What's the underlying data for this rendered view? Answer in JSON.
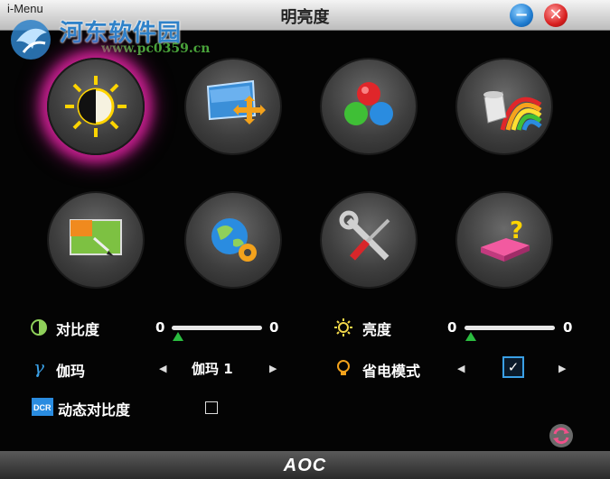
{
  "window": {
    "app_name": "i-Menu",
    "title": "明亮度",
    "minimize_icon": "minus-icon",
    "close_icon": "close-x-icon"
  },
  "watermark": {
    "name": "河东软件园",
    "url": "www.pc0359.cn"
  },
  "categories": [
    {
      "icon": "brightness-icon",
      "active": true
    },
    {
      "icon": "image-setup-icon",
      "active": false
    },
    {
      "icon": "color-setup-icon",
      "active": false
    },
    {
      "icon": "picture-boost-icon",
      "active": false
    },
    {
      "icon": "osd-setup-icon",
      "active": false
    },
    {
      "icon": "extra-globe-icon",
      "active": false
    },
    {
      "icon": "factory-tools-icon",
      "active": false
    },
    {
      "icon": "help-icon",
      "active": false
    }
  ],
  "settings": {
    "contrast": {
      "label": "对比度",
      "min_label": "0",
      "max_label": "0",
      "value": 0
    },
    "brightness": {
      "label": "亮度",
      "min_label": "0",
      "max_label": "0",
      "value": 0
    },
    "gamma": {
      "label": "伽玛",
      "value": "伽玛 1"
    },
    "eco_mode": {
      "label": "省电模式",
      "checked": true
    },
    "dcr": {
      "label": "动态对比度",
      "checked": false
    }
  },
  "footer": {
    "brand": "AOC"
  },
  "colors": {
    "accent_active": "#c11f8b",
    "slider_thumb": "#2bbd40",
    "checkbox": "#3aa0e6"
  }
}
